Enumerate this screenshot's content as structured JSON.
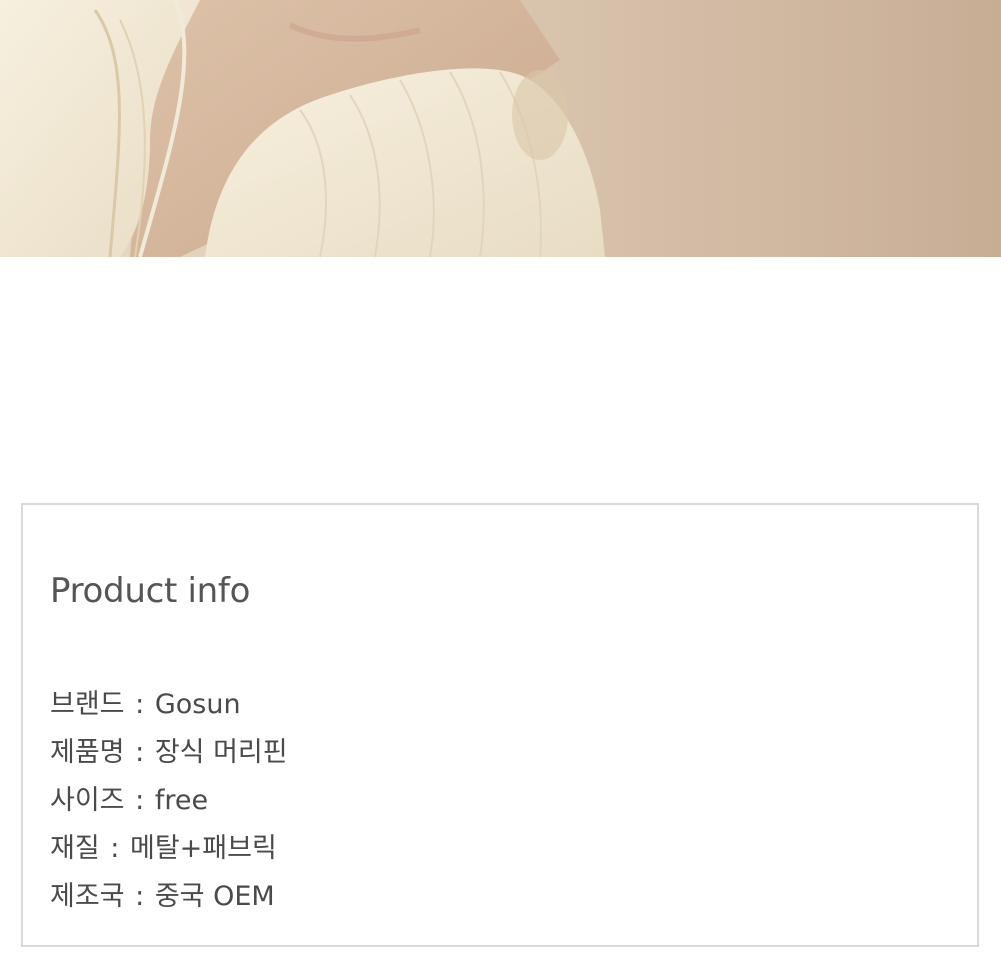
{
  "product_photo": {
    "alt": ""
  },
  "product_info": {
    "title": "Product info",
    "items": [
      {
        "label": "브랜드",
        "value": "Gosun"
      },
      {
        "label": "제품명",
        "value": "장식 머리핀"
      },
      {
        "label": "사이즈",
        "value": "free"
      },
      {
        "label": "재질",
        "value": "메탈+패브릭"
      },
      {
        "label": "제조국",
        "value": "중국 OEM"
      }
    ],
    "separator": ":"
  }
}
